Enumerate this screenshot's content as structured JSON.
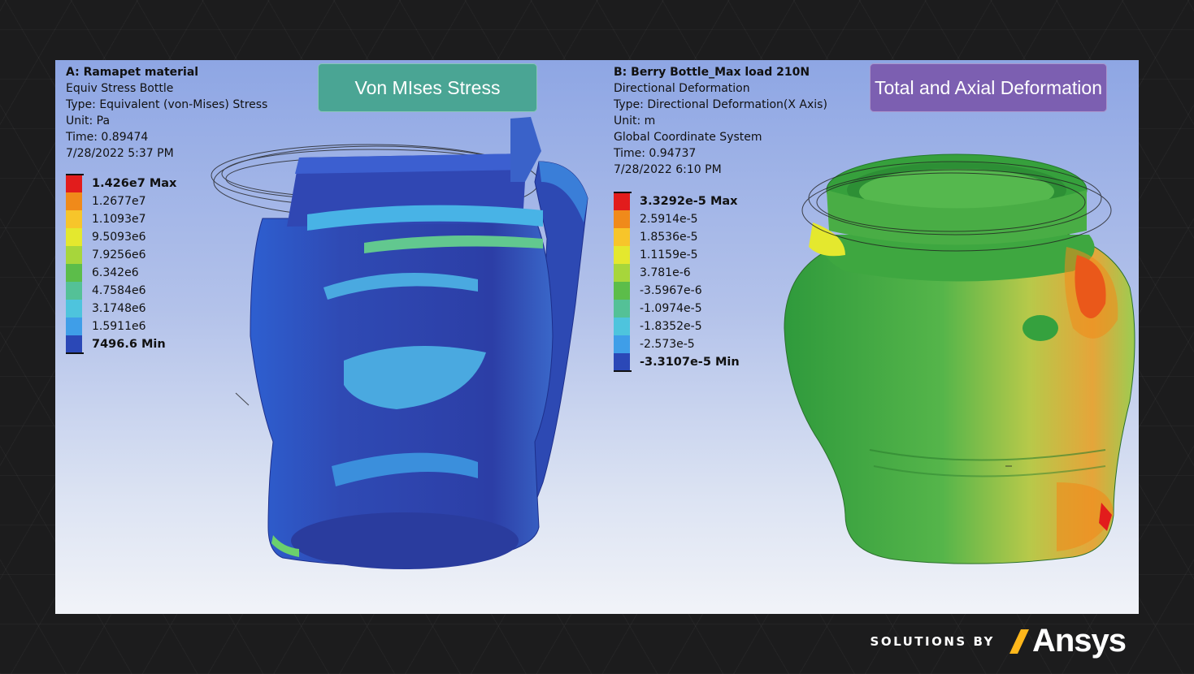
{
  "left_view": {
    "title": "A: Ramapet material",
    "lines": [
      "Equiv Stress Bottle",
      "Type: Equivalent (von-Mises) Stress",
      "Unit: Pa",
      "Time: 0.89474",
      "7/28/2022 5:37 PM"
    ],
    "badge": "Von MIses Stress",
    "legend": [
      "1.426e7 Max",
      "1.2677e7",
      "1.1093e7",
      "9.5093e6",
      "7.9256e6",
      "6.342e6",
      "4.7584e6",
      "3.1748e6",
      "1.5911e6",
      "7496.6 Min"
    ]
  },
  "right_view": {
    "title": "B: Berry Bottle_Max load 210N",
    "lines": [
      "Directional Deformation",
      "Type: Directional Deformation(X Axis)",
      "Unit: m",
      "Global Coordinate System",
      "Time: 0.94737",
      "7/28/2022 6:10 PM"
    ],
    "badge": "Total and Axial Deformation",
    "legend": [
      "3.3292e-5 Max",
      "2.5914e-5",
      "1.8536e-5",
      "1.1159e-5",
      "3.781e-6",
      "-3.5967e-6",
      "-1.0974e-5",
      "-1.8352e-5",
      "-2.573e-5",
      "-3.3107e-5 Min"
    ]
  },
  "legend_colors": [
    "#e21c1c",
    "#f08a1a",
    "#f7c52a",
    "#e4e82e",
    "#a7d63b",
    "#5cbd4a",
    "#54c197",
    "#4ec4dd",
    "#3f9ee8",
    "#2b48b7"
  ],
  "colors": {
    "badge_left": "#4aa594",
    "badge_right": "#7c5fb1",
    "logo_accent": "#ffb71b"
  },
  "branding": {
    "solutions_by": "SOLUTIONS BY",
    "logo": "Ansys"
  }
}
